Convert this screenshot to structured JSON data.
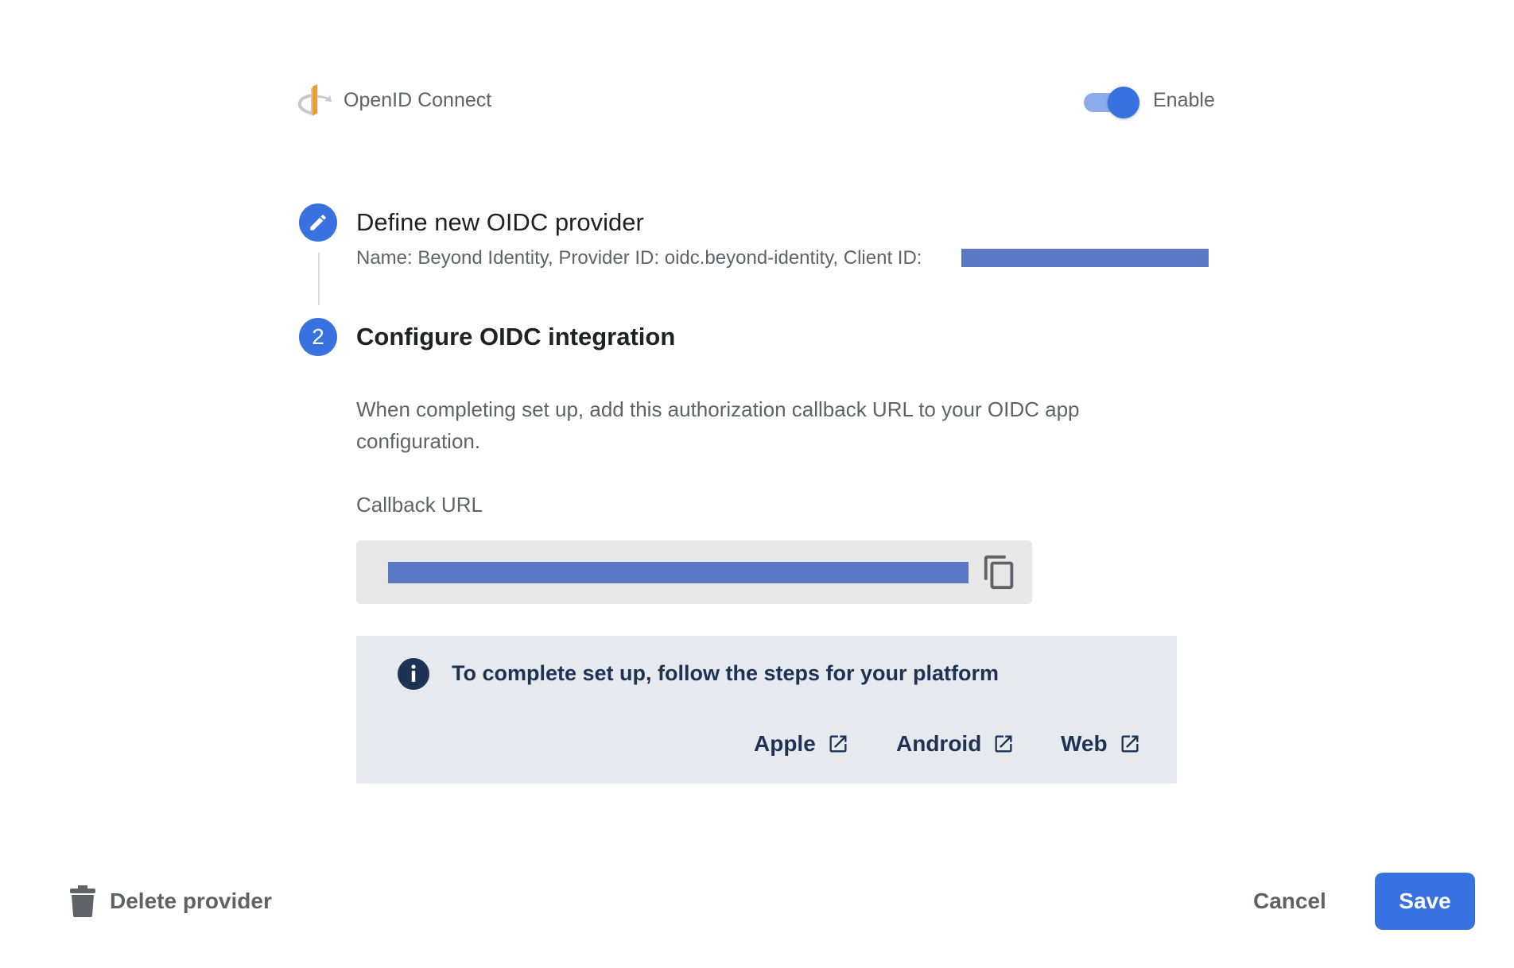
{
  "header": {
    "provider_name": "OpenID Connect",
    "enabled": true,
    "toggle_label": "Enable",
    "logo_icon": "openid-logo"
  },
  "steps": [
    {
      "index_icon": "pencil-icon",
      "title": "Define new OIDC provider",
      "summary": "Name: Beyond Identity, Provider ID: oidc.beyond-identity, Client ID:"
    },
    {
      "number": "2",
      "title": "Configure OIDC integration"
    }
  ],
  "configure": {
    "instructions": "When completing set up, add this authorization callback URL to your OIDC app configuration.",
    "callback_label": "Callback URL"
  },
  "info": {
    "text": "To complete set up, follow the steps for your platform",
    "links": [
      {
        "label": "Apple"
      },
      {
        "label": "Android"
      },
      {
        "label": "Web"
      }
    ]
  },
  "footer": {
    "delete_label": "Delete provider",
    "cancel_label": "Cancel",
    "save_label": "Save"
  },
  "colors": {
    "accent": "#3871e0",
    "redaction": "#5b78c4",
    "info_bg": "#e6e9ee",
    "info_text": "#1e3354"
  }
}
